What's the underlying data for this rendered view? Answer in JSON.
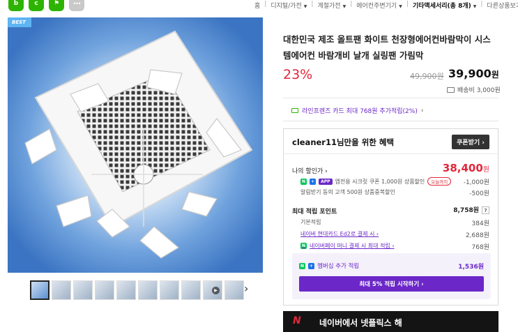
{
  "share": {
    "blog": "blog",
    "more": "···"
  },
  "breadcrumb": {
    "home": "홈",
    "c1": "디지털/가전",
    "c2": "계절가전",
    "c3": "에어컨주변기기",
    "c4": "기타액세서리(총 8개)",
    "c5": "다른상품보기"
  },
  "image": {
    "badge": "BEST"
  },
  "thumbnails": {
    "count": 10,
    "selected": 0,
    "next": "›"
  },
  "product": {
    "title": "대한민국 제조 올트팬 화이트 천장형에어컨바람막이 시스템에어컨 바람개비 날개 실링팬 가림막",
    "discount": "23%",
    "original_price": "49,900원",
    "price_num": "39,900",
    "price_unit": "원",
    "shipping": "배송비 3,000원"
  },
  "card_benefit": {
    "text": "라인프렌즈 카드 최대 768원 추가적립(2%)",
    "chevron": "›"
  },
  "benefits": {
    "title": "cleaner11님만을 위한 혜택",
    "coupon_button": "쿠폰받기 ›",
    "my_discount_label": "나의 할인가 ›",
    "my_discount_price": "38,400",
    "my_discount_unit": "원",
    "app_coupon": "앱전용 시크릿 쿠폰 1,000원 상품할인",
    "today_tag": "오늘까지",
    "app_coupon_value": "-1,000원",
    "alarm_coupon": "알림받기 동의 고객 500원 상품중복할인",
    "alarm_coupon_value": "-500원",
    "max_points_label": "최대 적립 포인트",
    "max_points_value": "8,758원",
    "qmark": "?",
    "basic_points_label": "기본적립",
    "basic_points_value": "384원",
    "hyundai_label": "네이버 현대카드 Ed2로 결제 시 ›",
    "hyundai_value": "2,688원",
    "npay_label": "네이버페이 머니 결제 시 최대 적립 ›",
    "npay_value": "768원",
    "tag_n": "N",
    "tag_plus": "+",
    "tag_app": "APP",
    "membership_label": "멤버십 추가 적립",
    "membership_value": "1,536원",
    "membership_button": "최대 5% 적립 시작하기 ›"
  },
  "banner": {
    "logo": "N",
    "text": "네이버에서 넷플릭스 해"
  },
  "colors": {
    "accent_red": "#e3263a",
    "purple": "#6b27c8",
    "naver_green": "#03c75a"
  }
}
